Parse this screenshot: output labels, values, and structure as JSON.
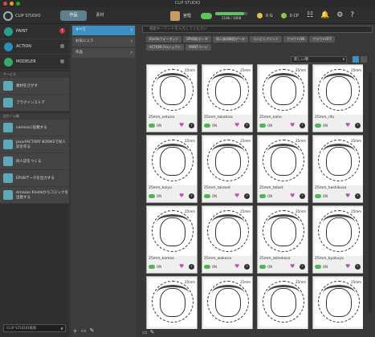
{
  "window": {
    "title": "CLIP STUDIO"
  },
  "header": {
    "logo_text": "CLIP STUDIO",
    "tabs": [
      {
        "label": "作品"
      },
      {
        "label": "素材"
      }
    ],
    "user_name": "宮樫",
    "storage_text": "1108 / 1008",
    "storage_fraction": 0.9,
    "gold_text": "0 G",
    "cp_text": "0 CP"
  },
  "sidebar": {
    "apps": [
      {
        "label": "PAINT",
        "color": "#2a9d8f"
      },
      {
        "label": "ACTION",
        "color": "#2a8fbd"
      },
      {
        "label": "MODELER",
        "color": "#3aaa6a"
      }
    ],
    "services_header": "サービス",
    "services": [
      {
        "label": "素材をさがす"
      },
      {
        "label": "プラグインストア"
      }
    ],
    "publish_header": "出力 / 公開",
    "publish": [
      {
        "label": "comicoに投稿する"
      },
      {
        "label": "pixivFACTORY BOOKSで同人誌を作る"
      },
      {
        "label": "同人誌をつくる"
      },
      {
        "label": "EPUBデータを出力する"
      },
      {
        "label": "Amazon Kindleからコミックを出版する"
      }
    ],
    "search_placeholder": "CLIP STUDIO検索"
  },
  "categories": [
    {
      "label": "すべて"
    },
    {
      "label": "お気に入り"
    },
    {
      "label": "作品"
    }
  ],
  "main": {
    "search_placeholder": "検索キーワードを入力してください",
    "chips": [
      "Kindleフォーマット",
      "EPUB形データ",
      "同人誌印刷用データ",
      "コンビニプリント",
      "クラウドON",
      "クラウドOFF",
      "ACTIONプロジェクト",
      "PAINTページ"
    ],
    "sort_label": "新しい順",
    "items": [
      {
        "name": "25mm_setuna",
        "tag": "25mm",
        "status": "ON"
      },
      {
        "name": "25mm_takahisa",
        "tag": "25mm",
        "status": "ON"
      },
      {
        "name": "25mm_kaho",
        "tag": "25mm",
        "status": "ON"
      },
      {
        "name": "25mm_rifu",
        "tag": "25mm",
        "status": "ON"
      },
      {
        "name": "25mm_kaiyu",
        "tag": "25mm",
        "status": "ON"
      },
      {
        "name": "25mm_tairoed",
        "tag": "25mm",
        "status": "ON"
      },
      {
        "name": "25mm_tolast",
        "tag": "25mm",
        "status": "ON"
      },
      {
        "name": "25mm_hashikusa",
        "tag": "25mm",
        "status": "ON"
      },
      {
        "name": "25mm_kamoe",
        "tag": "25mm",
        "status": "ON"
      },
      {
        "name": "25mm_wakana",
        "tag": "25mm",
        "status": "ON"
      },
      {
        "name": "25mm_akitokasa",
        "tag": "25mm",
        "status": "ON"
      },
      {
        "name": "25mm_byakuya",
        "tag": "25mm",
        "status": "ON"
      },
      {
        "name": "",
        "tag": "25mm",
        "status": ""
      },
      {
        "name": "",
        "tag": "25mm",
        "status": ""
      },
      {
        "name": "",
        "tag": "25mm",
        "status": ""
      },
      {
        "name": "",
        "tag": "25mm",
        "status": ""
      }
    ]
  }
}
